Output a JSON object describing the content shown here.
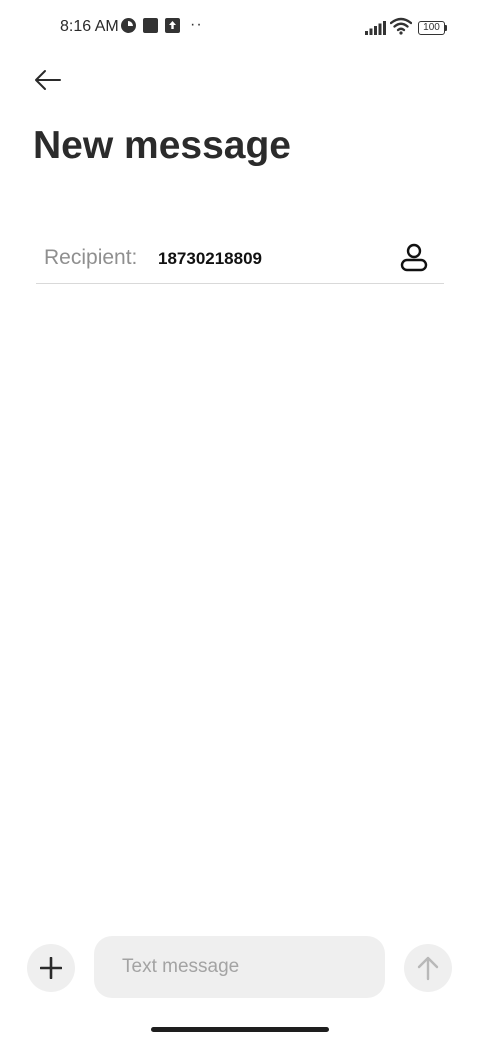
{
  "status_bar": {
    "time": "8:16 AM",
    "dots": "··",
    "battery": "100",
    "icons": [
      "pie-icon",
      "square-icon",
      "upload-icon",
      "signal-icon",
      "wifi-icon",
      "battery-icon"
    ]
  },
  "header": {
    "back_icon": "arrow-left-icon",
    "title": "New message"
  },
  "recipient": {
    "label": "Recipient:",
    "value": "18730218809",
    "contact_icon": "person-icon"
  },
  "composer": {
    "add_icon": "plus-icon",
    "placeholder": "Text message",
    "send_icon": "arrow-up-icon"
  },
  "colors": {
    "background": "#ffffff",
    "text": "#2b2b2b",
    "muted": "#8f8f8f",
    "field_bg": "#efefef",
    "divider": "#d9d9d9"
  }
}
